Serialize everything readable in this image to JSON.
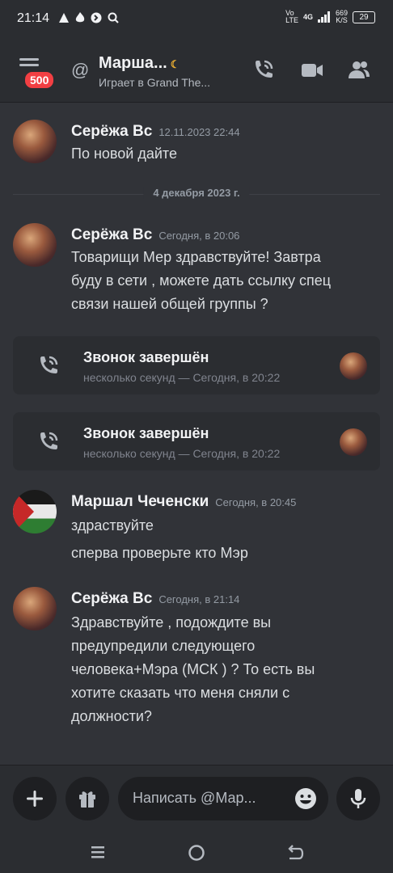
{
  "status": {
    "time": "21:14",
    "net_vo": "Vo",
    "net_lte": "LTE",
    "net_4g": "4G",
    "speed_value": "669",
    "speed_unit": "K/S",
    "battery": "29"
  },
  "header": {
    "unread_badge": "500",
    "title": "Марша...",
    "subtitle": "Играет в Grand The..."
  },
  "messages": [
    {
      "author": "Серёжа Вс",
      "time": "12.11.2023 22:44",
      "lines": [
        "По новой дайте"
      ]
    },
    {
      "author": "Серёжа Вс",
      "time": "Сегодня, в 20:06",
      "lines": [
        "Товарищи Мер здравствуйте! Завтра",
        "буду в сети , можете дать ссылку спец",
        "связи нашей общей группы ?"
      ]
    },
    {
      "author": "Маршал Чеченски",
      "time": "Сегодня, в 20:45",
      "lines": [
        "здраствуйте"
      ],
      "extra": "сперва проверьте кто Мэр"
    },
    {
      "author": "Серёжа Вс",
      "time": "Сегодня, в 21:14",
      "lines": [
        "Здравствуйте , подождите вы",
        "предупредили следующего",
        "человека+Мэра (МСК ) ? То есть вы",
        "хотите сказать что меня сняли с",
        "должности?"
      ]
    }
  ],
  "date_divider": "4 декабря 2023 г.",
  "calls": [
    {
      "title": "Звонок завершён",
      "subtitle": "несколько секунд — Сегодня, в 20:22"
    },
    {
      "title": "Звонок завершён",
      "subtitle": "несколько секунд — Сегодня, в 20:22"
    }
  ],
  "composer": {
    "placeholder": "Написать @Мар..."
  },
  "colors": {
    "background": "#313338",
    "header": "#2b2d31",
    "badge": "#f23f43",
    "status_idle": "#f0b232"
  }
}
